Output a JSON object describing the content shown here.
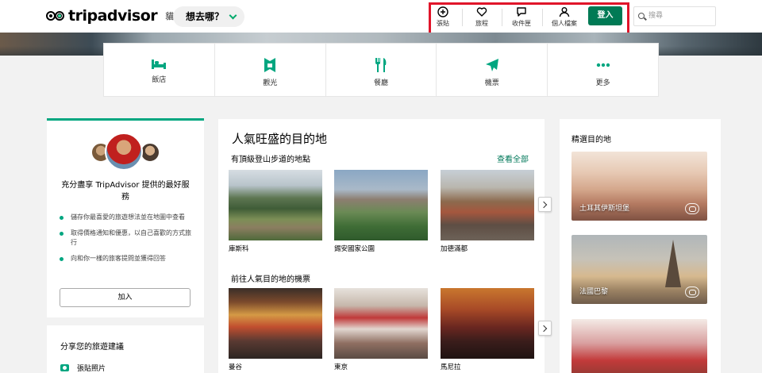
{
  "header": {
    "logo_text": "tripadvisor",
    "logo_sub": "貓途鷹",
    "where_label": "想去哪？",
    "nav": [
      {
        "label": "張貼",
        "icon": "plus-circle-icon"
      },
      {
        "label": "旅程",
        "icon": "heart-icon"
      },
      {
        "label": "收件匣",
        "icon": "chat-icon"
      },
      {
        "label": "個人檔案",
        "icon": "user-icon"
      }
    ],
    "login_label": "登入",
    "search_placeholder": "搜尋"
  },
  "categories": [
    {
      "label": "飯店",
      "icon": "bed-icon"
    },
    {
      "label": "觀光",
      "icon": "landmark-icon"
    },
    {
      "label": "餐廳",
      "icon": "fork-knife-icon"
    },
    {
      "label": "機票",
      "icon": "plane-icon"
    },
    {
      "label": "更多",
      "icon": "more-dots-icon"
    }
  ],
  "promo": {
    "title": "充分盡享 TripAdvisor 提供的最好服務",
    "bullets": [
      "儲存你最喜愛的旅遊想法並在地圖中查看",
      "取得價格通知和優惠，以自己喜歡的方式旅行",
      "向和你一樣的旅客提問並獲得回答"
    ],
    "join_label": "加入"
  },
  "share": {
    "title": "分享您的旅遊建議",
    "item_label": "張貼照片"
  },
  "popular": {
    "title": "人氣旺盛的目的地",
    "section1_title": "有頂級登山步道的地點",
    "see_all": "查看全部",
    "section1_cards": [
      "庫斯科",
      "錫安國家公園",
      "加德滿都"
    ],
    "section2_title": "前往人氣目的地的機票",
    "section2_cards": [
      "曼谷",
      "東京",
      "馬尼拉"
    ]
  },
  "featured": {
    "title": "精選目的地",
    "cards": [
      "土耳其伊斯坦堡",
      "法國巴黎",
      ""
    ]
  },
  "colors": {
    "brand_green": "#00a680",
    "login_green": "#007a55",
    "highlight_red": "#e0152a"
  }
}
